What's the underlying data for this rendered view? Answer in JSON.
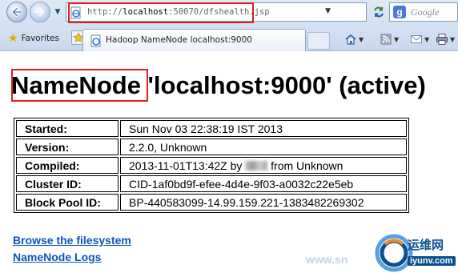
{
  "browser": {
    "address_url_prefix": "http://",
    "address_url_host": "localhost",
    "address_url_rest": ":50070/dfshealth.jsp",
    "search_placeholder": "Google",
    "favorites_label": "Favorites",
    "tab_label": "Hadoop NameNode localhost:9000",
    "icons": {
      "back": "back-arrow-icon",
      "forward": "forward-arrow-icon",
      "refresh": "refresh-icon",
      "stop": "stop-icon",
      "home": "home-icon",
      "feeds": "rss-icon",
      "mail": "mail-icon",
      "print": "printer-icon"
    },
    "highlight_color": "#e01e1e"
  },
  "page": {
    "title_part1": "NameNode",
    "title_part2": " 'localhost:9000' (active)",
    "info_rows": [
      {
        "label": "Started:",
        "value": "Sun Nov 03 22:38:19 IST 2013"
      },
      {
        "label": "Version:",
        "value": "2.2.0, Unknown"
      },
      {
        "label": "Compiled:",
        "value_prefix": "2013-11-01T13:42Z by",
        "value_suffix": "from Unknown"
      },
      {
        "label": "Cluster ID:",
        "value": "CID-1af0bd9f-efee-4d4e-9f03-a0032c22e5eb"
      },
      {
        "label": "Block Pool ID:",
        "value": "BP-440583099-14.99.159.221-1383482269302"
      }
    ],
    "links": {
      "browse": "Browse the filesystem",
      "logs": "NameNode Logs"
    },
    "link_color": "#0b57b8"
  },
  "watermark": {
    "text": "www.sn",
    "site_name_cn": "运维网",
    "site_url": "iyunv.com"
  }
}
